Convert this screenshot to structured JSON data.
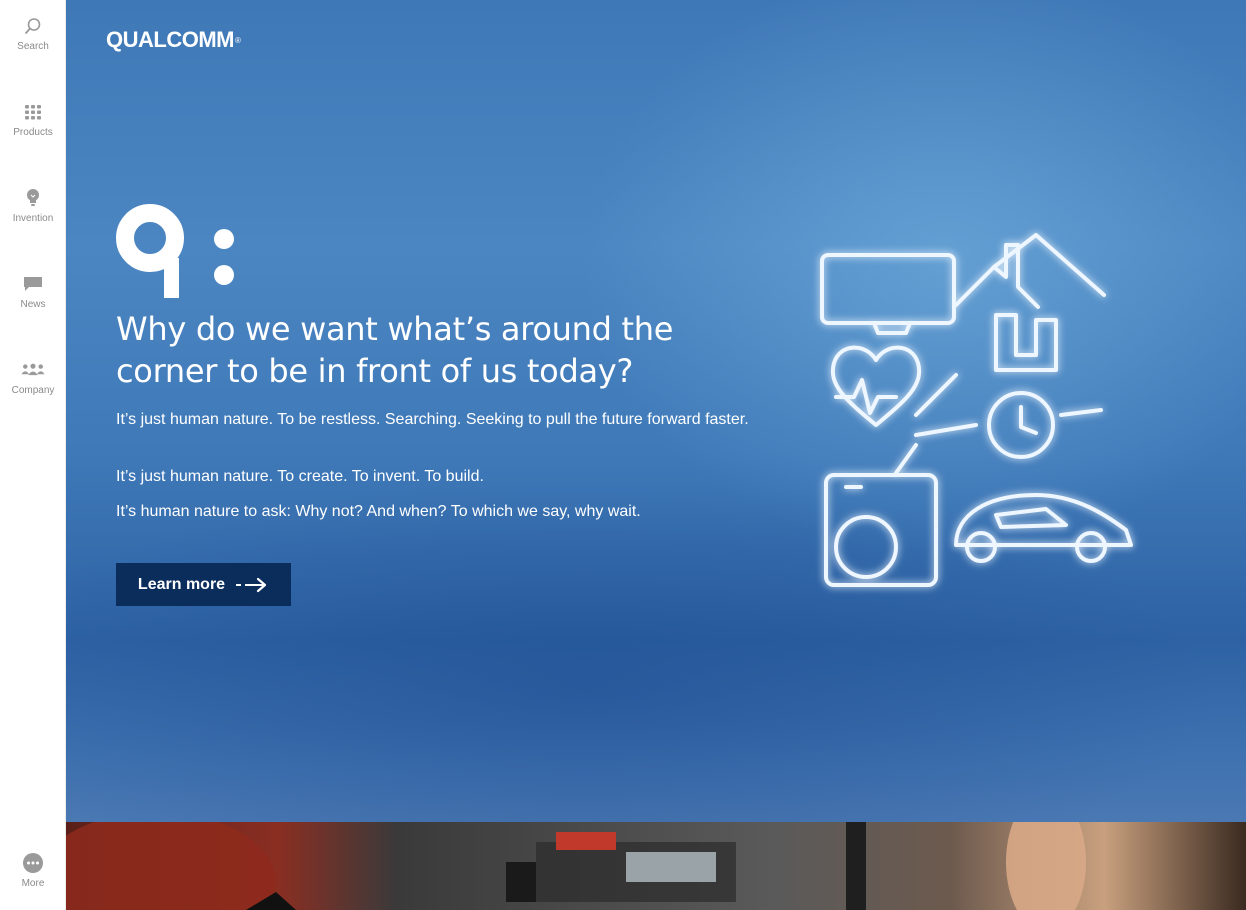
{
  "sidebar": {
    "items": [
      {
        "label": "Search",
        "icon": "search-icon"
      },
      {
        "label": "Products",
        "icon": "grid-icon"
      },
      {
        "label": "Invention",
        "icon": "lightbulb-icon"
      },
      {
        "label": "News",
        "icon": "chat-bubble-icon"
      },
      {
        "label": "Company",
        "icon": "people-icon"
      },
      {
        "label": "More",
        "icon": "more-dots-icon"
      }
    ]
  },
  "header": {
    "logo_text": "QUALCOMM",
    "logo_mark": "®"
  },
  "hero": {
    "headline": "Why do we want what’s around the corner to be in front of us today?",
    "paragraphs": [
      "It’s just human nature. To be restless. Searching. Seeking to pull the future forward faster.",
      "It’s just human nature. To create. To invent. To build.",
      "It’s human nature to ask: Why not? And when? To which we say, why wait."
    ],
    "cta_label": "Learn more"
  },
  "colors": {
    "hero_blue": "#3f78b6",
    "cta_bg": "#0b2d5c",
    "sidebar_text": "#8a8a8a"
  }
}
